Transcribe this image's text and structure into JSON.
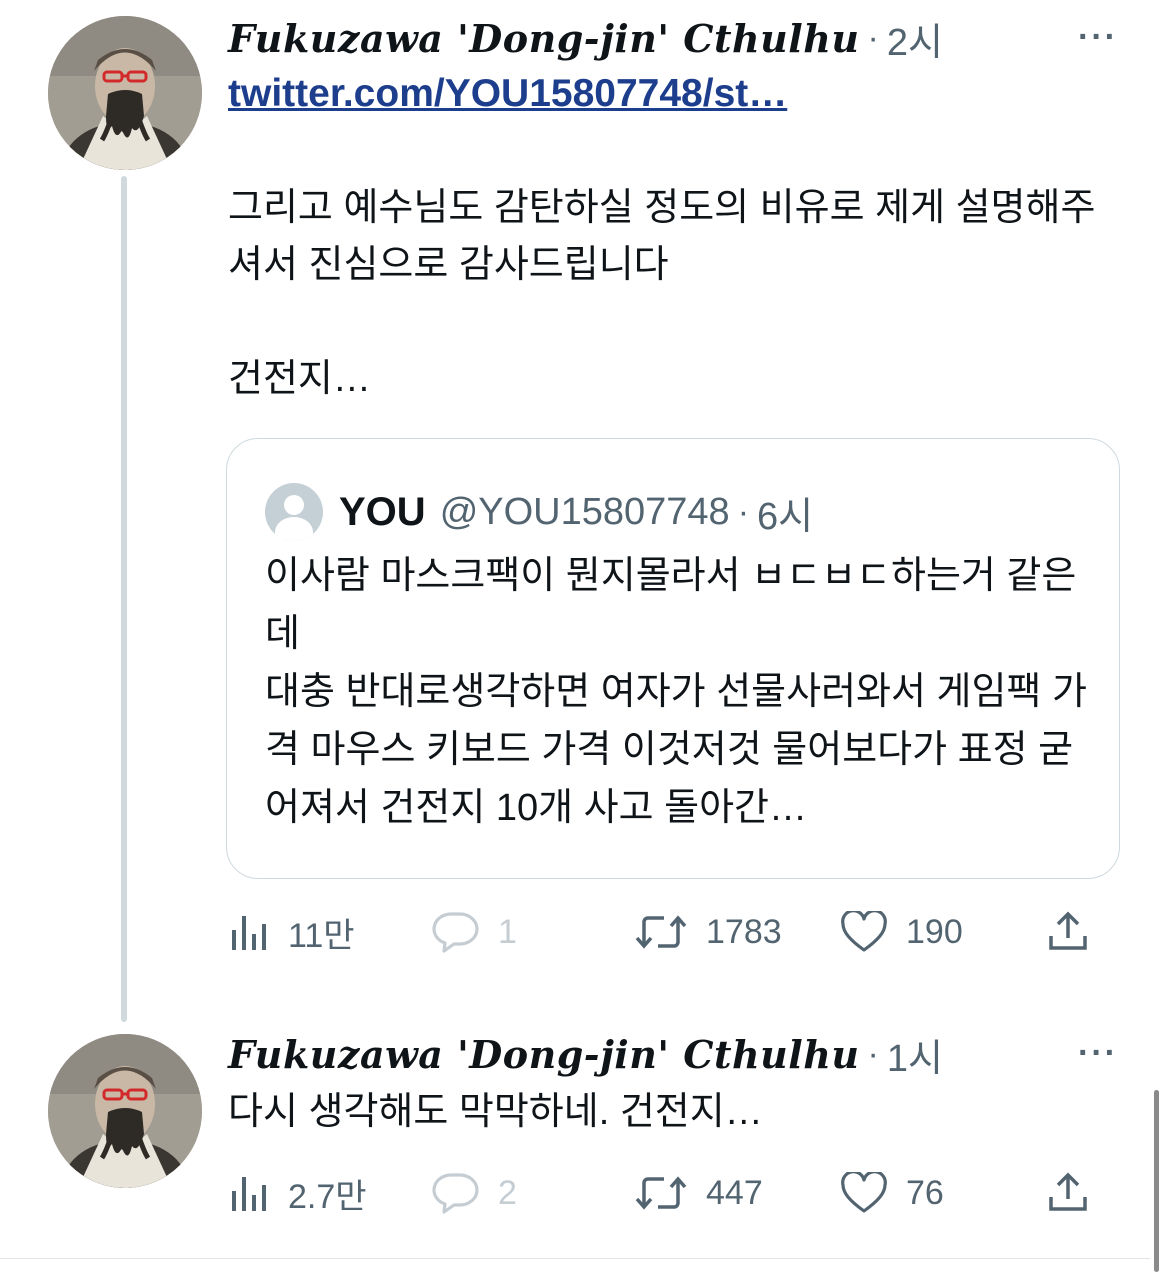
{
  "thread": [
    {
      "author_name": "Fukuzawa 'Dong-jin' Cthulhu",
      "time": "2시",
      "link": "twitter.com/YOU15807748/st…",
      "text": "그리고 예수님도 감탄하실 정도의 비유로 제게 설명해주셔서 진심으로 감사드립니다\n\n건전지…",
      "quote": {
        "name": "YOU",
        "handle": "@YOU15807748",
        "time": "6시",
        "text": "이사람 마스크팩이 뭔지몰라서 ㅂㄷㅂㄷ하는거 같은데\n대충 반대로생각하면 여자가 선물사러와서 게임팩 가격 마우스 키보드 가격 이것저것 물어보다가 표정 굳어져서 건전지 10개 사고 돌아간…"
      },
      "stats": {
        "views": "11만",
        "replies": "1",
        "retweets": "1783",
        "likes": "190"
      }
    },
    {
      "author_name": "Fukuzawa 'Dong-jin' Cthulhu",
      "time": "1시",
      "text": "다시 생각해도 막막하네. 건전지…",
      "stats": {
        "views": "2.7만",
        "replies": "2",
        "retweets": "447",
        "likes": "76"
      }
    }
  ],
  "separator": "·",
  "more_label": "···",
  "icons": {
    "avatar": "avatar-portrait-icon",
    "views": "bar-chart-icon",
    "reply": "speech-bubble-icon",
    "retweet": "retweet-arrows-icon",
    "like": "heart-icon",
    "share": "share-upload-icon",
    "more": "more-dots-icon",
    "quote_avatar": "default-user-icon"
  },
  "colors": {
    "text": "#0f1419",
    "secondary": "#536471",
    "link": "#1d3e8c",
    "border": "#cfd9de"
  }
}
